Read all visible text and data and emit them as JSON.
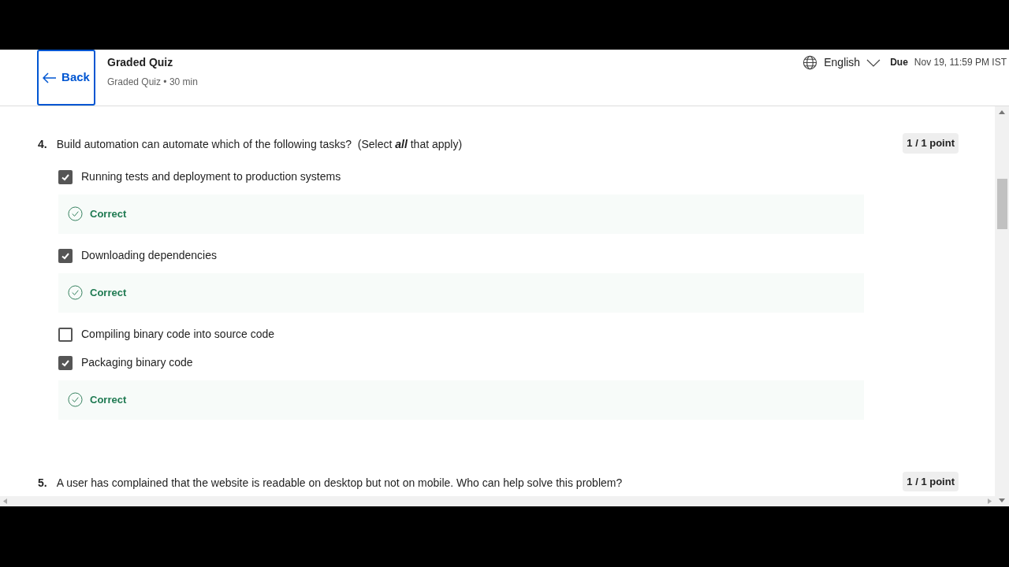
{
  "header": {
    "back": "Back",
    "title": "Graded Quiz",
    "subtitle": "Graded Quiz • 30 min",
    "language": "English",
    "due_label": "Due",
    "due_value": "Nov 19, 11:59 PM IST"
  },
  "questions": [
    {
      "number": "4.",
      "text": "Build automation can automate which of the following tasks?  (Select **all** that apply)",
      "points": "1 / 1 point",
      "options": [
        {
          "label": "Running tests and deployment to production systems",
          "checked": true,
          "feedback": "Correct"
        },
        {
          "label": "Downloading dependencies",
          "checked": true,
          "feedback": "Correct"
        },
        {
          "label": "Compiling binary code into source code",
          "checked": false
        },
        {
          "label": "Packaging binary code",
          "checked": true,
          "feedback": "Correct"
        }
      ]
    },
    {
      "number": "5.",
      "text": "A user has complained that the website is readable on desktop but not on mobile. Who can help solve this problem?",
      "points": "1 / 1 point"
    }
  ]
}
